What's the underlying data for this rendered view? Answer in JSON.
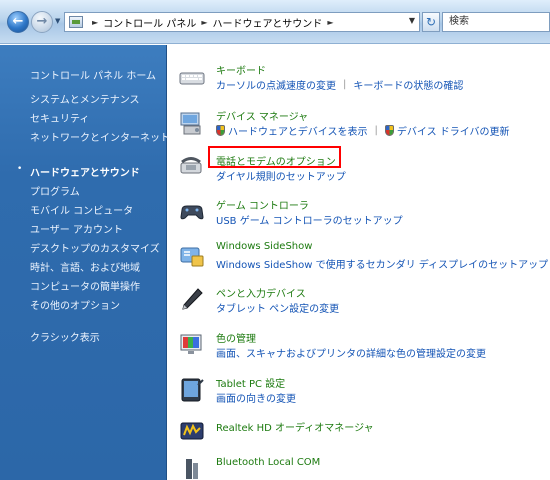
{
  "address_bar": {
    "breadcrumbs": [
      "コントロール パネル",
      "ハードウェアとサウンド"
    ],
    "search_placeholder": "検索"
  },
  "sidebar": {
    "home": "コントロール パネル ホーム",
    "items": [
      {
        "label": "システムとメンテナンス"
      },
      {
        "label": "セキュリティ"
      },
      {
        "label": "ネットワークとインターネット"
      },
      {
        "label": "ハードウェアとサウンド",
        "active": true
      },
      {
        "label": "プログラム"
      },
      {
        "label": "モバイル コンピュータ"
      },
      {
        "label": "ユーザー アカウント"
      },
      {
        "label": "デスクトップのカスタマイズ"
      },
      {
        "label": "時計、言語、および地域"
      },
      {
        "label": "コンピュータの簡単操作"
      },
      {
        "label": "その他のオプション"
      }
    ],
    "classic_view": "クラシック表示"
  },
  "categories": [
    {
      "icon": "keyboard-icon",
      "title": "キーボード",
      "links": [
        "カーソルの点滅速度の変更",
        "キーボードの状態の確認"
      ]
    },
    {
      "icon": "device-manager-icon",
      "title": "デバイス マネージャ",
      "links": [
        "ハードウェアとデバイスを表示",
        "デバイス ドライバの更新"
      ]
    },
    {
      "icon": "phone-modem-icon",
      "title": "電話とモデムのオプション",
      "links": [
        "ダイヤル規則のセットアップ"
      ]
    },
    {
      "icon": "game-controller-icon",
      "title": "ゲーム コントローラ",
      "links": [
        "USB ゲーム コントローラのセットアップ"
      ]
    },
    {
      "icon": "sideshow-icon",
      "title": "Windows SideShow",
      "links": [
        "Windows SideShow で使用するセカンダリ ディスプレイのセットアップ"
      ]
    },
    {
      "icon": "pen-input-icon",
      "title": "ペンと入力デバイス",
      "links": [
        "タブレット ペン設定の変更"
      ]
    },
    {
      "icon": "color-management-icon",
      "title": "色の管理",
      "links": [
        "画面、スキャナおよびプリンタの詳細な色の管理設定の変更"
      ]
    },
    {
      "icon": "tablet-pc-icon",
      "title": "Tablet PC 設定",
      "links": [
        "画面の向きの変更"
      ]
    },
    {
      "icon": "realtek-audio-icon",
      "title": "Realtek HD オーディオマネージャ",
      "links": []
    },
    {
      "icon": "bluetooth-icon",
      "title": "Bluetooth Local COM",
      "links": []
    }
  ],
  "colors": {
    "highlight": "#ff0000",
    "link": "#1454b5",
    "category_title": "#1c7a0f",
    "sidebar_bg": "#2f6cae"
  }
}
